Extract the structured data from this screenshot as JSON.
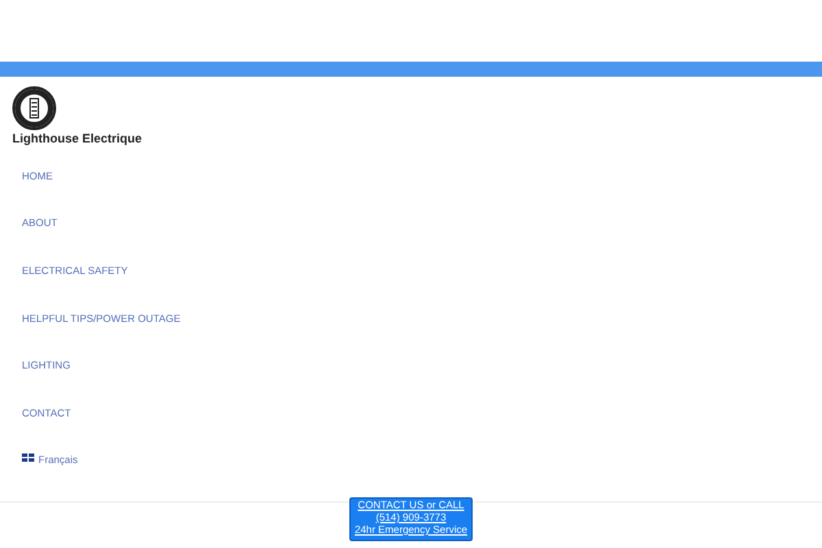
{
  "site": {
    "title": "Lighthouse Electrique"
  },
  "nav": [
    {
      "label": "HOME",
      "kind": "link"
    },
    {
      "label": "ABOUT",
      "kind": "link"
    },
    {
      "label": "ELECTRICAL SAFETY",
      "kind": "link"
    },
    {
      "label": "HELPFUL TIPS/POWER OUTAGE",
      "kind": "link"
    },
    {
      "label": "LIGHTING",
      "kind": "link"
    },
    {
      "label": "CONTACT",
      "kind": "link"
    },
    {
      "label": "Français",
      "kind": "language"
    }
  ],
  "cta": {
    "lines": [
      "CONTACT US or CALL",
      "(514) 909-3773",
      "24hr Emergency Service"
    ]
  }
}
